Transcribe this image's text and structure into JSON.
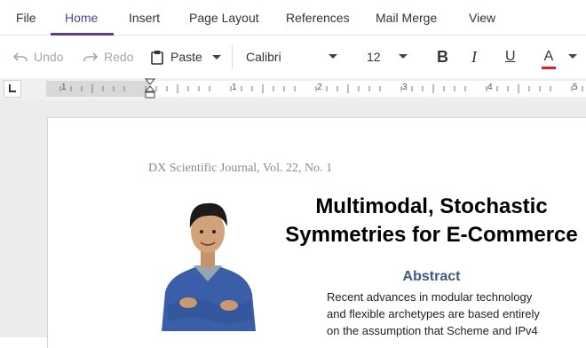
{
  "ribbon": {
    "tabs": [
      {
        "label": "File"
      },
      {
        "label": "Home"
      },
      {
        "label": "Insert"
      },
      {
        "label": "Page Layout"
      },
      {
        "label": "References"
      },
      {
        "label": "Mail Merge"
      },
      {
        "label": "View"
      }
    ],
    "active_tab": "Home"
  },
  "toolbar": {
    "undo_label": "Undo",
    "redo_label": "Redo",
    "paste_label": "Paste",
    "font_family": "Calibri",
    "font_size": "12",
    "bold_label": "B",
    "italic_label": "I",
    "underline_label": "U",
    "font_color_label": "A",
    "font_color": "#e02020"
  },
  "ruler": {
    "labels": [
      "1",
      "1",
      "2",
      "3",
      "4",
      "5"
    ]
  },
  "document": {
    "journal_header": "DX Scientific Journal, Vol. 22, No. 1",
    "title_line1": "Multimodal, Stochastic",
    "title_line2": "Symmetries for E-Commerce",
    "abstract_heading": "Abstract",
    "abstract_lines": [
      "Recent advances in modular technology",
      "and flexible archetypes are based entirely",
      "on the assumption that Scheme and IPv4"
    ]
  },
  "colors": {
    "accent": "#5b3f8f",
    "abstract_heading": "#3d5a80",
    "workspace": "#ececec"
  }
}
